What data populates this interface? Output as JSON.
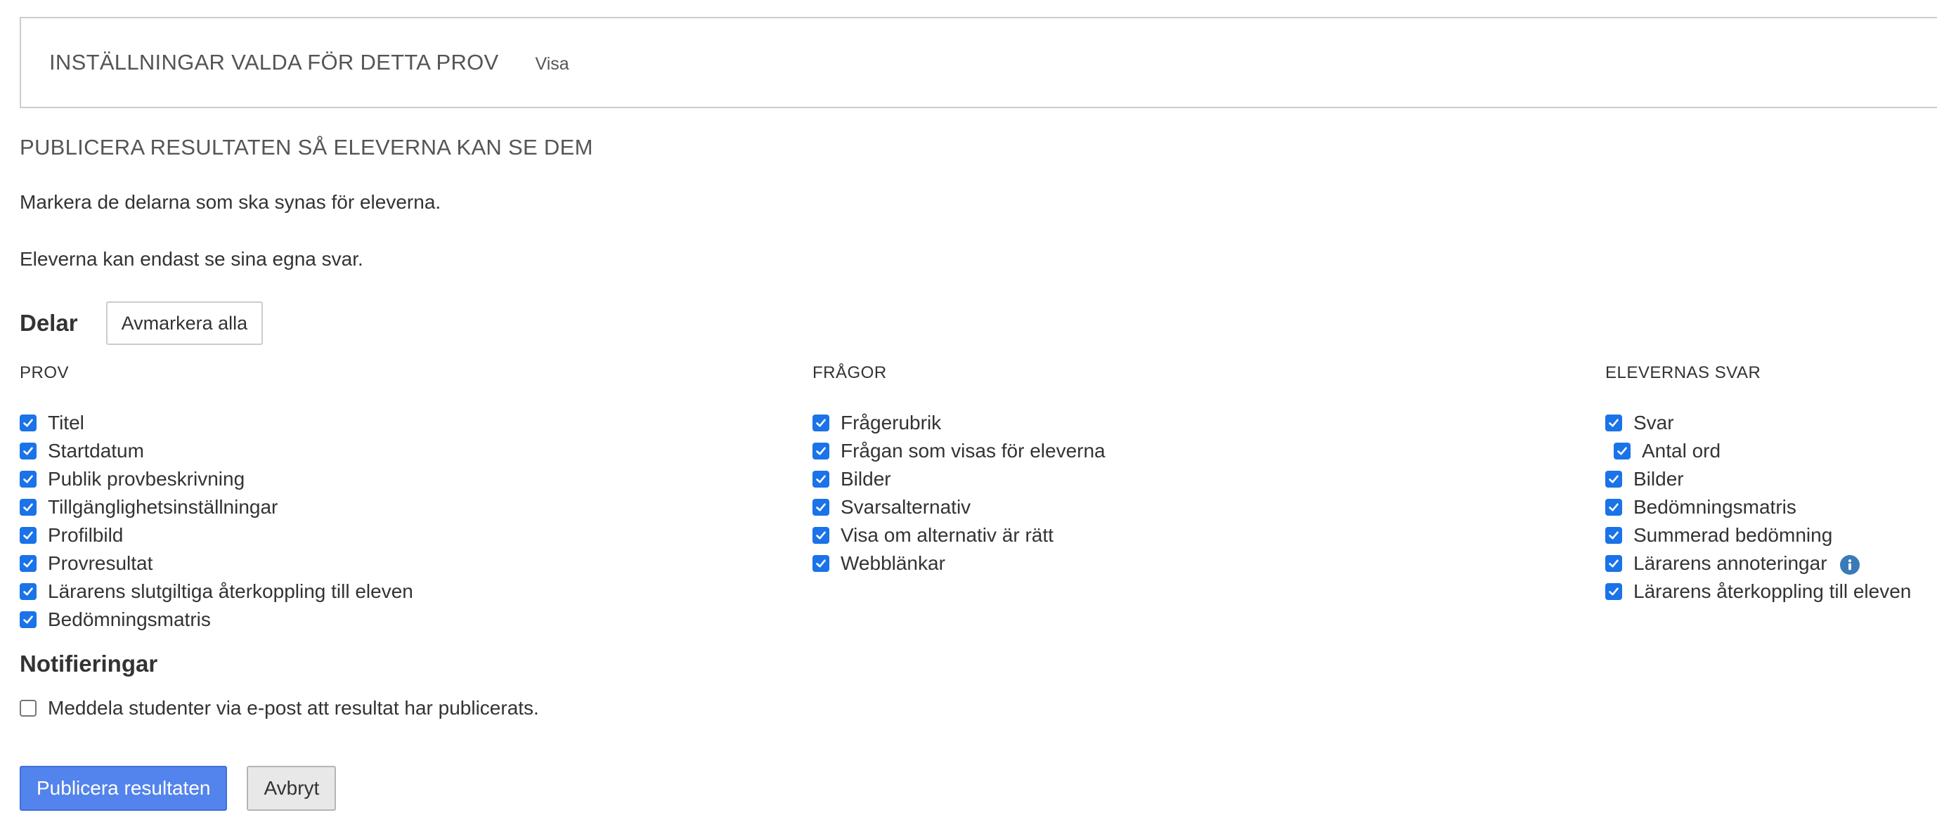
{
  "settings": {
    "title": "INSTÄLLNINGAR VALDA FÖR DETTA PROV",
    "toggle_label": "Visa"
  },
  "publish": {
    "heading": "PUBLICERA RESULTATEN SÅ ELEVERNA KAN SE DEM",
    "instruction_1": "Markera de delarna som ska synas för eleverna.",
    "instruction_2": "Eleverna kan endast se sina egna svar."
  },
  "parts": {
    "label": "Delar",
    "deselect_all_label": "Avmarkera alla",
    "columns": [
      {
        "heading": "PROV",
        "items": [
          {
            "label": "Titel",
            "checked": true
          },
          {
            "label": "Startdatum",
            "checked": true
          },
          {
            "label": "Publik provbeskrivning",
            "checked": true
          },
          {
            "label": "Tillgänglighetsinställningar",
            "checked": true
          },
          {
            "label": "Profilbild",
            "checked": true
          },
          {
            "label": "Provresultat",
            "checked": true
          },
          {
            "label": "Lärarens slutgiltiga återkoppling till eleven",
            "checked": true
          },
          {
            "label": "Bedömningsmatris",
            "checked": true
          }
        ]
      },
      {
        "heading": "FRÅGOR",
        "items": [
          {
            "label": "Frågerubrik",
            "checked": true
          },
          {
            "label": "Frågan som visas för eleverna",
            "checked": true
          },
          {
            "label": "Bilder",
            "checked": true
          },
          {
            "label": "Svarsalternativ",
            "checked": true
          },
          {
            "label": "Visa om alternativ är rätt",
            "checked": true
          },
          {
            "label": "Webblänkar",
            "checked": true
          }
        ]
      },
      {
        "heading": "ELEVERNAS SVAR",
        "items": [
          {
            "label": "Svar",
            "checked": true
          },
          {
            "label": "Antal ord",
            "checked": true
          },
          {
            "label": "Bilder",
            "checked": true
          },
          {
            "label": "Bedömningsmatris",
            "checked": true
          },
          {
            "label": "Summerad bedömning",
            "checked": true
          },
          {
            "label": "Lärarens annoteringar",
            "checked": true
          },
          {
            "label": "Lärarens återkoppling till eleven",
            "checked": true
          }
        ]
      }
    ]
  },
  "notifications": {
    "heading": "Notifieringar",
    "email_label": "Meddela studenter via e-post att resultat har publicerats.",
    "email_checked": false
  },
  "actions": {
    "publish_label": "Publicera resultaten",
    "cancel_label": "Avbryt"
  },
  "colors": {
    "checkbox_accent": "#1a73e8",
    "primary_button": "#5383ec",
    "info_icon": "#3a7ab8"
  }
}
